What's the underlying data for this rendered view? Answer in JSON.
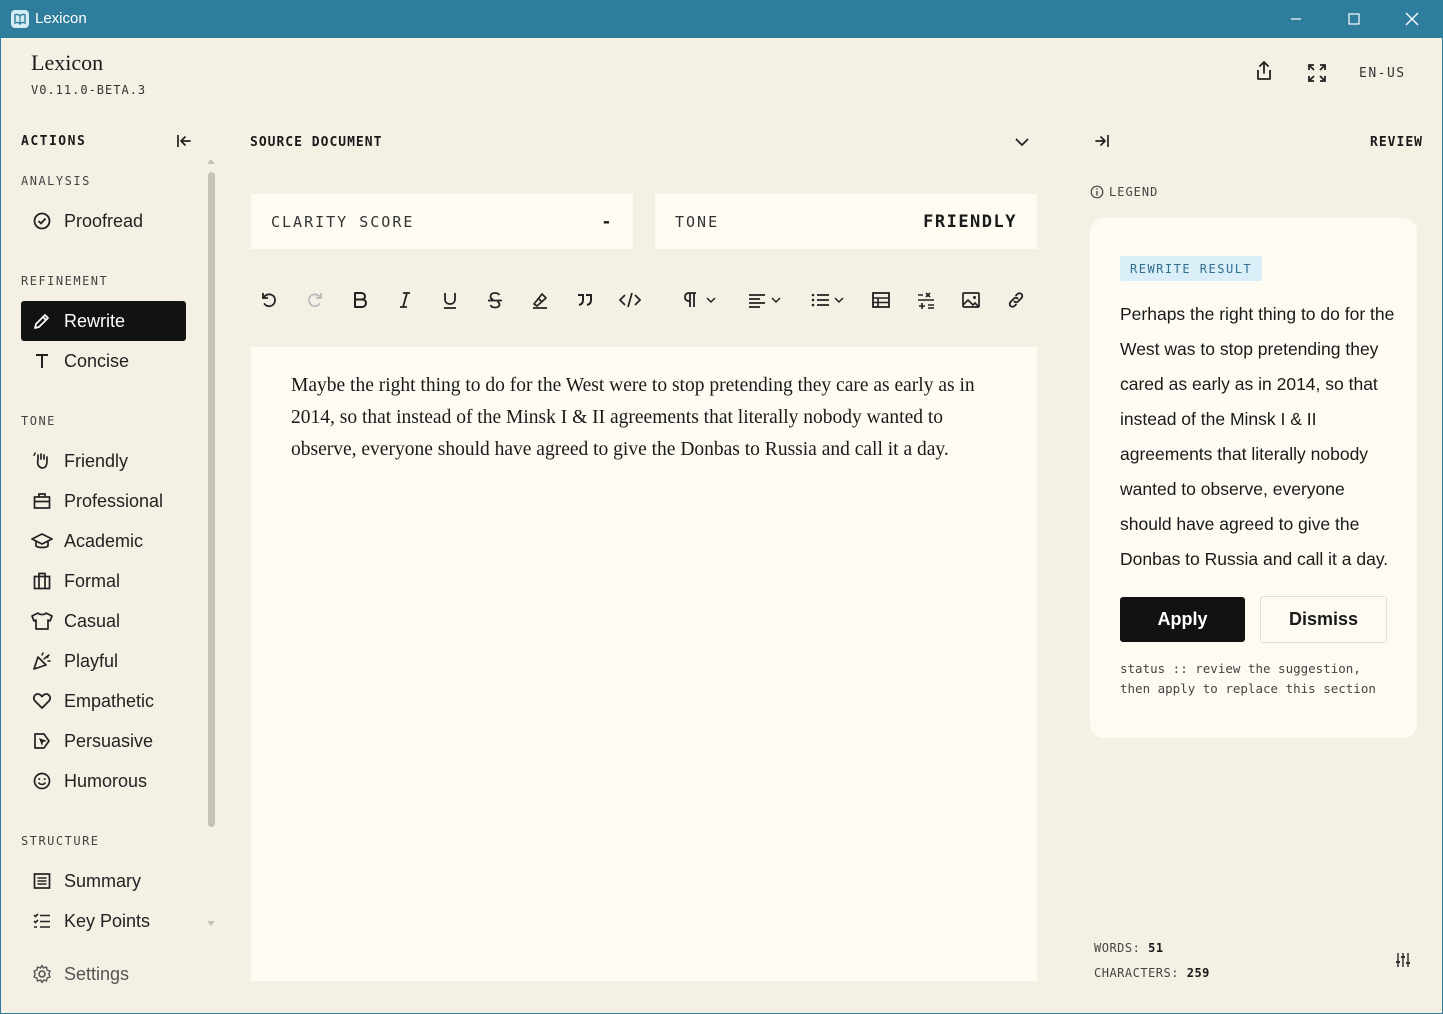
{
  "window": {
    "title": "Lexicon"
  },
  "brand": {
    "name": "Lexicon",
    "version": "V0.11.0-BETA.3"
  },
  "header": {
    "locale": "EN-US"
  },
  "sidebar": {
    "title": "ACTIONS",
    "sections": {
      "analysis": "ANALYSIS",
      "refinement": "REFINEMENT",
      "tone": "TONE",
      "structure": "STRUCTURE"
    },
    "items": {
      "proofread": "Proofread",
      "rewrite": "Rewrite",
      "concise": "Concise",
      "friendly": "Friendly",
      "professional": "Professional",
      "academic": "Academic",
      "formal": "Formal",
      "casual": "Casual",
      "playful": "Playful",
      "empathetic": "Empathetic",
      "persuasive": "Persuasive",
      "humorous": "Humorous",
      "summary": "Summary",
      "key_points": "Key Points"
    },
    "settings": "Settings",
    "active_item": "Rewrite"
  },
  "source": {
    "title": "SOURCE DOCUMENT",
    "clarity_label": "CLARITY SCORE",
    "clarity_value": "-",
    "tone_label": "TONE",
    "tone_value": "FRIENDLY",
    "text": "Maybe the right thing to do for the West were to stop pretending they care as early as in 2014, so that instead of the Minsk I & II agreements that literally nobody wanted to observe, everyone should have agreed to give the Donbas to Russia and call it a day."
  },
  "toolbar": [
    "undo-icon",
    "redo-icon",
    "bold-icon",
    "italic-icon",
    "underline-icon",
    "strikethrough-icon",
    "highlight-icon",
    "quote-icon",
    "code-icon",
    "paragraph-icon",
    "align-icon",
    "list-icon",
    "table-icon",
    "insert-row-icon",
    "image-icon",
    "link-icon"
  ],
  "review": {
    "title": "REVIEW",
    "legend": "LEGEND",
    "badge": "REWRITE RESULT",
    "result": "Perhaps the right thing to do for the West was to stop pretending they cared as early as in 2014, so that instead of the Minsk I & II agreements that literally nobody wanted to observe, everyone should have agreed to give the Donbas to Russia and call it a day.",
    "apply": "Apply",
    "dismiss": "Dismiss",
    "status": "status :: review the suggestion, then apply to replace this section"
  },
  "stats": {
    "words_label": "WORDS:",
    "words": "51",
    "chars_label": "CHARACTERS:",
    "chars": "259"
  },
  "colors": {
    "titlebar": "#2E7D9C",
    "background": "#F5F0E4",
    "card": "#FDFBF2",
    "accent": "#121212",
    "badge_bg": "#D9EEF7"
  }
}
